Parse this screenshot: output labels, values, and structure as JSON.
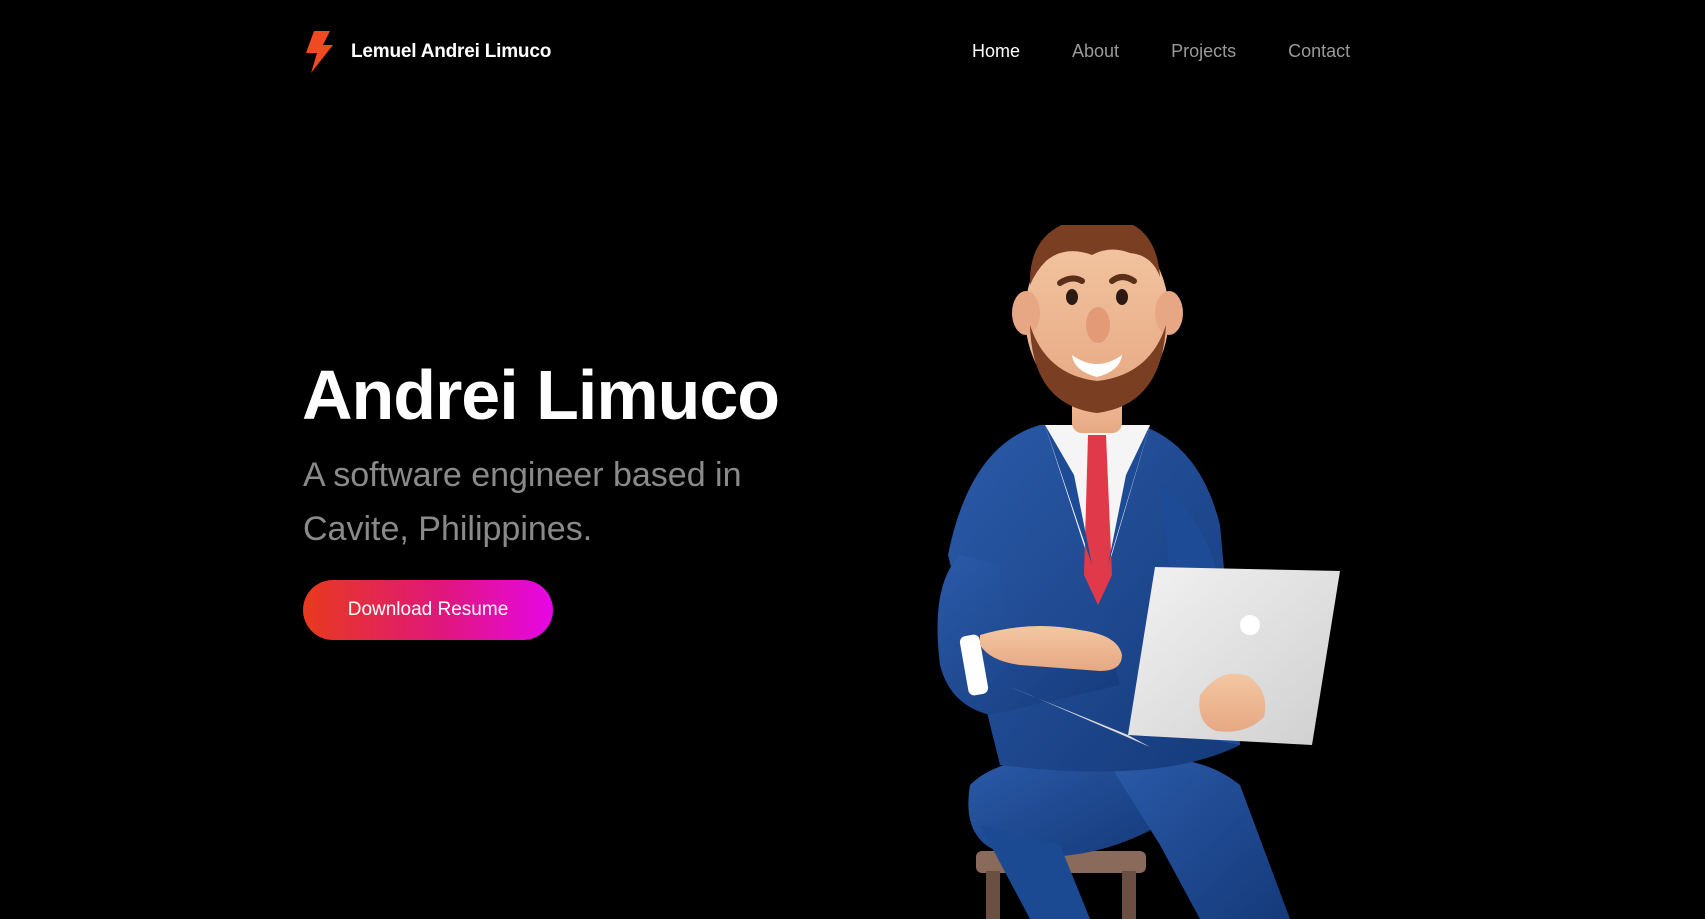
{
  "header": {
    "brand_name": "Lemuel Andrei Limuco",
    "brand_icon": "lightning-bolt-icon",
    "nav": [
      {
        "label": "Home",
        "active": true
      },
      {
        "label": "About",
        "active": false
      },
      {
        "label": "Projects",
        "active": false
      },
      {
        "label": "Contact",
        "active": false
      }
    ]
  },
  "hero": {
    "title": "Andrei Limuco",
    "subtitle": "A software engineer based in Cavite, Philippines.",
    "cta_label": "Download Resume"
  },
  "colors": {
    "background": "#000000",
    "accent_start": "#e83a1c",
    "accent_end": "#e606e6",
    "nav_inactive": "#9a9a9a"
  }
}
